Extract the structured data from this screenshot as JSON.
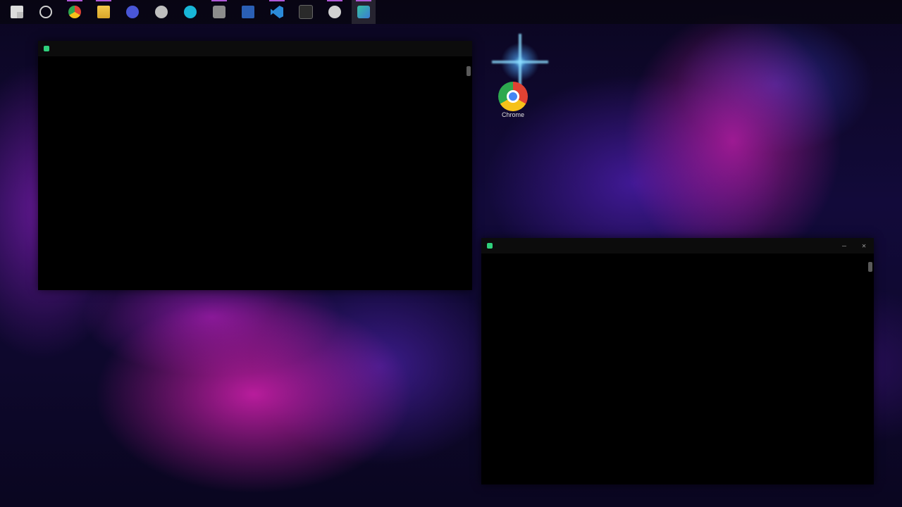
{
  "taskbar": {
    "items": [
      {
        "name": "start",
        "icon": "windows-icon"
      },
      {
        "name": "search",
        "icon": "search-icon"
      },
      {
        "name": "chrome",
        "icon": "chrome-icon"
      },
      {
        "name": "file-explorer",
        "icon": "folder-icon"
      },
      {
        "name": "app-blue",
        "icon": "app-icon"
      },
      {
        "name": "settings",
        "icon": "gear-icon"
      },
      {
        "name": "app-cyan",
        "icon": "app-icon"
      },
      {
        "name": "app-grey",
        "icon": "app-icon"
      },
      {
        "name": "visual-studio",
        "icon": "visual-studio-icon"
      },
      {
        "name": "vscode",
        "icon": "vscode-icon"
      },
      {
        "name": "terminal",
        "icon": "terminal-icon"
      },
      {
        "name": "snipping",
        "icon": "snip-icon"
      },
      {
        "name": "terminal-preview",
        "icon": "terminal-icon"
      }
    ],
    "clock_time": "",
    "clock_date": ""
  },
  "desktop": {
    "icons": [
      {
        "label": "Chrome",
        "icon": "chrome-icon"
      }
    ]
  },
  "windows": {
    "left": {
      "title": "",
      "lines": [
        "",
        "",
        "",
        "",
        ""
      ]
    },
    "right": {
      "title": "",
      "lines": [
        "",
        "",
        ""
      ]
    }
  },
  "colors": {
    "accent": "#b05ad8",
    "terminal_bg": "#000000",
    "link_blue": "#3b7bff"
  }
}
